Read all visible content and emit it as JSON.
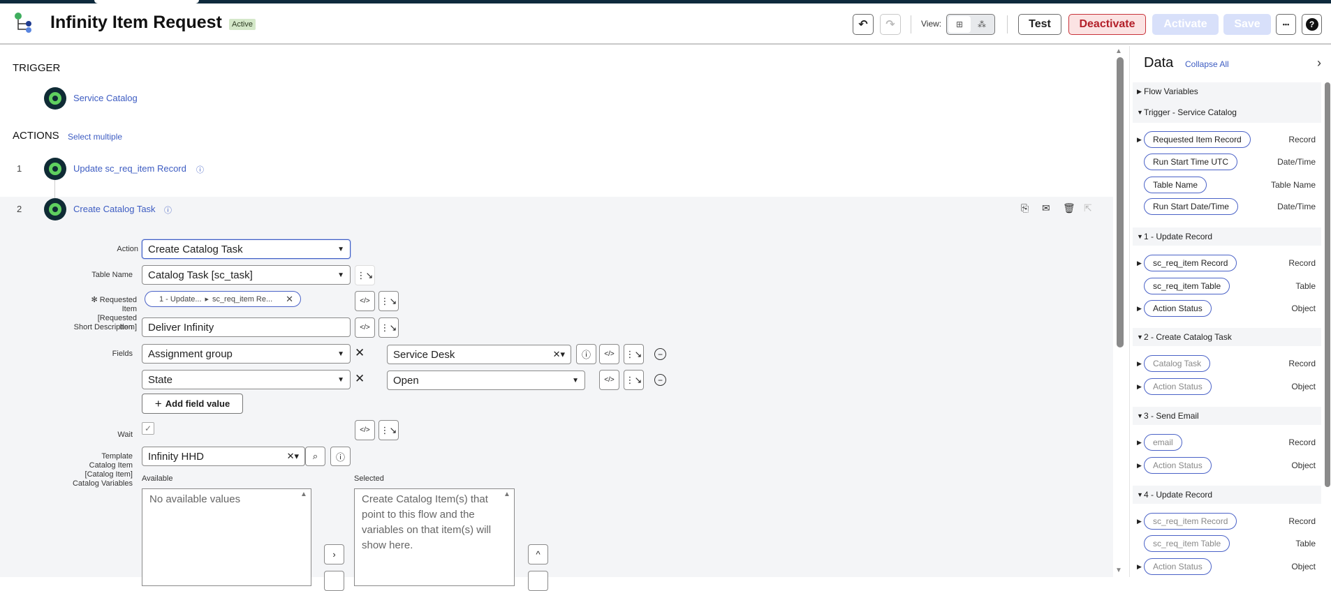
{
  "header": {
    "title": "Infinity Item Request",
    "status": "Active",
    "view_label": "View:",
    "buttons": {
      "test": "Test",
      "deactivate": "Deactivate",
      "activate": "Activate",
      "save": "Save",
      "more": "•••",
      "help": "?"
    }
  },
  "main": {
    "trigger_heading": "TRIGGER",
    "trigger_name": "Service Catalog",
    "actions_heading": "ACTIONS",
    "select_multiple": "Select multiple",
    "actions": [
      {
        "num": "1",
        "name": "Update sc_req_item Record"
      },
      {
        "num": "2",
        "name": "Create Catalog Task"
      }
    ],
    "form": {
      "action_label": "Action",
      "action_value": "Create Catalog Task",
      "table_label": "Table Name",
      "table_value": "Catalog Task [sc_task]",
      "requested_label": "✻ Requested Item [Requested Item]",
      "requested_pill_1": "1 - Update...",
      "requested_pill_2": "sc_req_item Re...",
      "short_desc_label": "Short Description",
      "short_desc_value": "Deliver Infinity",
      "fields_label": "Fields",
      "fields": [
        {
          "field": "Assignment group",
          "value": "Service Desk"
        },
        {
          "field": "State",
          "value": "Open"
        }
      ],
      "add_field": "Add field value",
      "wait_label": "Wait",
      "template_label": "Template Catalog Item [Catalog Item]",
      "template_value": "Infinity HHD",
      "catalog_vars_label": "Catalog Variables",
      "available_label": "Available",
      "selected_label": "Selected",
      "available_empty": "No available values",
      "selected_hint": "Create Catalog Item(s) that point to this flow and the variables on that item(s) will show here."
    }
  },
  "data_panel": {
    "title": "Data",
    "collapse_all": "Collapse All",
    "flow_variables": "Flow Variables",
    "sections": [
      {
        "title": "Trigger - Service Catalog",
        "items": [
          {
            "label": "Requested Item Record",
            "type": "Record",
            "expand": true,
            "dim": false
          },
          {
            "label": "Run Start Time UTC",
            "type": "Date/Time",
            "expand": false,
            "dim": false
          },
          {
            "label": "Table Name",
            "type": "Table Name",
            "expand": false,
            "dim": false
          },
          {
            "label": "Run Start Date/Time",
            "type": "Date/Time",
            "expand": false,
            "dim": false
          }
        ]
      },
      {
        "title": "1 - Update Record",
        "items": [
          {
            "label": "sc_req_item Record",
            "type": "Record",
            "expand": true,
            "dim": false
          },
          {
            "label": "sc_req_item Table",
            "type": "Table",
            "expand": false,
            "dim": false
          },
          {
            "label": "Action Status",
            "type": "Object",
            "expand": true,
            "dim": false
          }
        ]
      },
      {
        "title": "2 - Create Catalog Task",
        "items": [
          {
            "label": "Catalog Task",
            "type": "Record",
            "expand": true,
            "dim": true
          },
          {
            "label": "Action Status",
            "type": "Object",
            "expand": true,
            "dim": true
          }
        ]
      },
      {
        "title": "3 - Send Email",
        "items": [
          {
            "label": "email",
            "type": "Record",
            "expand": true,
            "dim": true
          },
          {
            "label": "Action Status",
            "type": "Object",
            "expand": true,
            "dim": true
          }
        ]
      },
      {
        "title": "4 - Update Record",
        "items": [
          {
            "label": "sc_req_item Record",
            "type": "Record",
            "expand": true,
            "dim": true
          },
          {
            "label": "sc_req_item Table",
            "type": "Table",
            "expand": false,
            "dim": true
          },
          {
            "label": "Action Status",
            "type": "Object",
            "expand": true,
            "dim": true
          }
        ]
      }
    ]
  }
}
